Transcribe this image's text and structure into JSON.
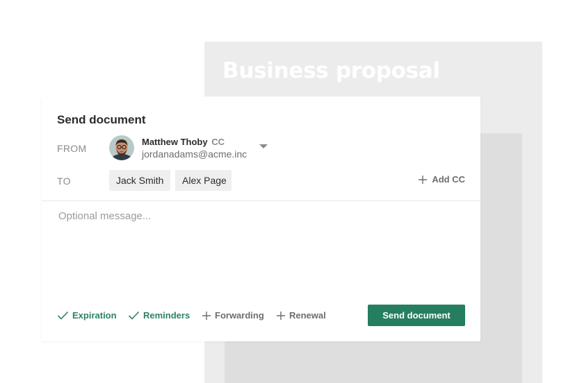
{
  "background_document": {
    "title": "Business proposal"
  },
  "dialog": {
    "title": "Send document",
    "from": {
      "label": "FROM",
      "sender_name": "Matthew Thoby",
      "sender_cc": "CC",
      "sender_email": "jordanadams@acme.inc",
      "dropdown_icon": "caret-down-icon"
    },
    "to": {
      "label": "TO",
      "recipients": [
        "Jack Smith",
        "Alex Page"
      ],
      "add_cc_label": "Add CC"
    },
    "message": {
      "placeholder": "Optional message...",
      "value": ""
    },
    "options": [
      {
        "label": "Expiration",
        "enabled": true,
        "icon": "check-icon"
      },
      {
        "label": "Reminders",
        "enabled": true,
        "icon": "check-icon"
      },
      {
        "label": "Forwarding",
        "enabled": false,
        "icon": "plus-icon"
      },
      {
        "label": "Renewal",
        "enabled": false,
        "icon": "plus-icon"
      }
    ],
    "send_label": "Send document"
  },
  "colors": {
    "accent": "#267e60",
    "option_on": "#2e8163",
    "muted_text": "#8a8a8a",
    "doc_background": "#ececec",
    "doc_inner": "#dedede"
  }
}
